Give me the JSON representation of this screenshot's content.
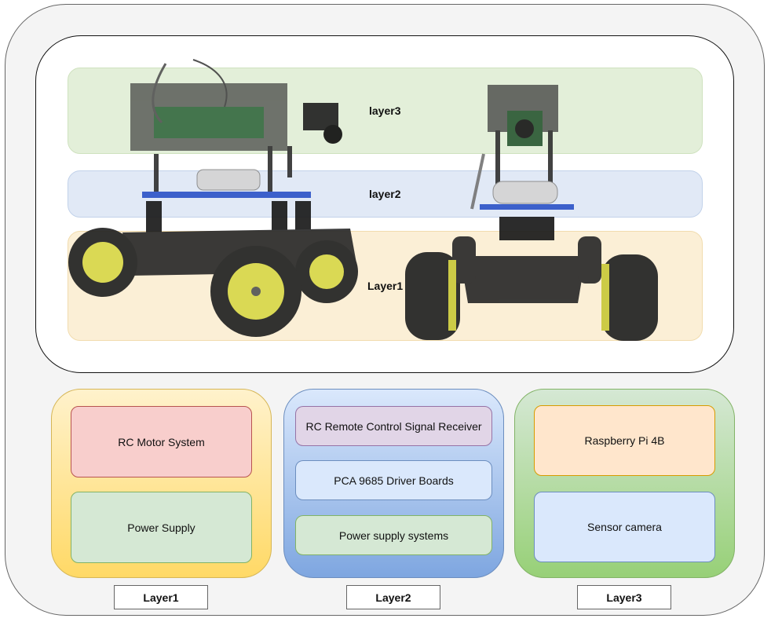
{
  "photo_panel": {
    "bands": {
      "layer3": "layer3",
      "layer2": "layer2",
      "layer1": "Layer1"
    }
  },
  "columns": {
    "layer1": {
      "items": [
        "RC Motor System",
        "Power Supply"
      ],
      "tag": "Layer1"
    },
    "layer2": {
      "items": [
        "RC Remote Control Signal Receiver",
        "PCA 9685 Driver Boards",
        "Power supply systems"
      ],
      "tag": "Layer2"
    },
    "layer3": {
      "items": [
        "Raspberry Pi 4B",
        "Sensor camera"
      ],
      "tag": "Layer3"
    }
  },
  "colors": {
    "layer1_fill": "#ffd966",
    "layer2_fill": "#7ea6e0",
    "layer3_fill": "#97d077",
    "rover_base": "#2a2a2a",
    "wheel_hub": "#d8d84a",
    "deck_blue": "#2f55c8"
  }
}
